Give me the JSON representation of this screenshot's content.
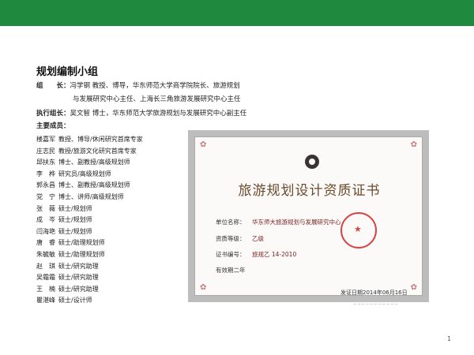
{
  "header": {
    "bar_color": "#1f8a3e"
  },
  "title": "规划编制小组",
  "leader": {
    "label": "组　　长：",
    "line1": "冯学钢 教授、博导，华东师范大学商学院院长、旅游规划",
    "line2": "与发展研究中心主任、上海长三角旅游发展研究中心主任"
  },
  "exec_leader": {
    "label": "执行组长：",
    "text": "吴文智 博士，华东师范大学旅游规划与发展研究中心副主任"
  },
  "members_label": "主要成员：",
  "members": [
    {
      "name": "楼嘉军",
      "desc": "教授、博导/休闲研究首席专家"
    },
    {
      "name": "庄志民",
      "desc": "教授/旅游文化研究首席专家"
    },
    {
      "name": "邱扶东",
      "desc": "博士、副教授/高级规划师"
    },
    {
      "name": "李　桦",
      "desc": "研究员/高级规划师"
    },
    {
      "name": "郭永昌",
      "desc": "博士、副教授/高级规划师"
    },
    {
      "name": "党　宁",
      "desc": "博士、讲师/高级规划师"
    },
    {
      "name": "张　薇",
      "desc": "硕士/规划师"
    },
    {
      "name": "成　岑",
      "desc": "硕士/规划师"
    },
    {
      "name": "闫海艳",
      "desc": "硕士/规划师"
    },
    {
      "name": "唐　睿",
      "desc": "硕士/助理规划师"
    },
    {
      "name": "朱毓敏",
      "desc": "硕士/助理规划师"
    },
    {
      "name": "赵　琪",
      "desc": "硕士/研究助理"
    },
    {
      "name": "吴霜霜",
      "desc": "硕士/研究助理"
    },
    {
      "name": "王　楠",
      "desc": "硕士/研究助理"
    },
    {
      "name": "瞿湛峰",
      "desc": "硕士/设计师"
    }
  ],
  "certificate": {
    "title": "旅游规划设计资质证书",
    "unit_label": "单位名称：",
    "unit_value": "华东师大旅游规划与发展研究中心",
    "grade_label": "资质等级：",
    "grade_value": "乙级",
    "number_label": "证书编号：",
    "number_value": "旅规乙 14-2010",
    "validity": "有效期二年",
    "issue_date": "发证日期2014年06月16日"
  },
  "page_number": "1"
}
